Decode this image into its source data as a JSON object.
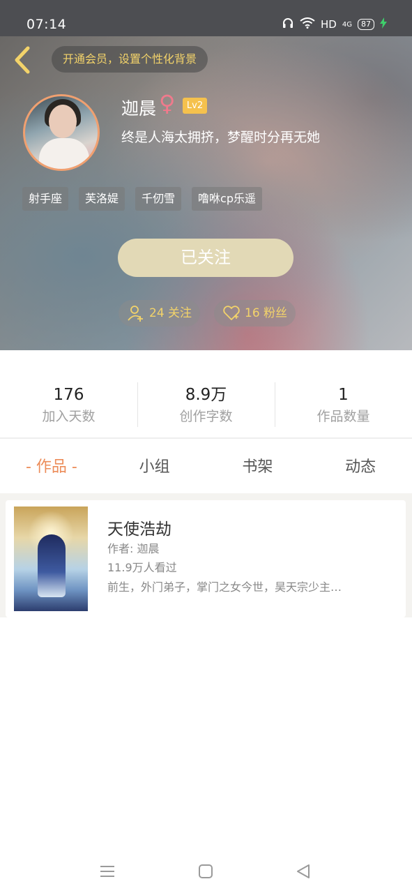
{
  "status_bar": {
    "time": "07:14",
    "network": "HD",
    "signal": "4G",
    "battery": "87"
  },
  "header": {
    "vip_banner": "开通会员，设置个性化背景"
  },
  "profile": {
    "name": "迦晨",
    "gender_symbol": "♀",
    "level": "Lv2",
    "signature": "终是人海太拥挤，梦醒时分再无她",
    "tags": [
      "射手座",
      "芙洛媞",
      "千仞雪",
      "噜咻cp乐遥"
    ],
    "follow_button": "已关注",
    "following": "24 关注",
    "fans": "16 粉丝"
  },
  "stats": [
    {
      "value": "176",
      "label": "加入天数"
    },
    {
      "value": "8.9万",
      "label": "创作字数"
    },
    {
      "value": "1",
      "label": "作品数量"
    }
  ],
  "tabs": [
    {
      "label": "- 作品 -",
      "active": true
    },
    {
      "label": "小组",
      "active": false
    },
    {
      "label": "书架",
      "active": false
    },
    {
      "label": "动态",
      "active": false
    }
  ],
  "works": [
    {
      "title": "天使浩劫",
      "author": "作者: 迦晨",
      "views": "11.9万人看过",
      "description": "前生，外门弟子，掌门之女今世，昊天宗少主…"
    }
  ],
  "colors": {
    "accent": "#ec8c59",
    "gold": "#f3d36a",
    "follow_button": "#e2d9b6",
    "level_badge": "#f5c14d",
    "gender": "#f07a8c"
  }
}
